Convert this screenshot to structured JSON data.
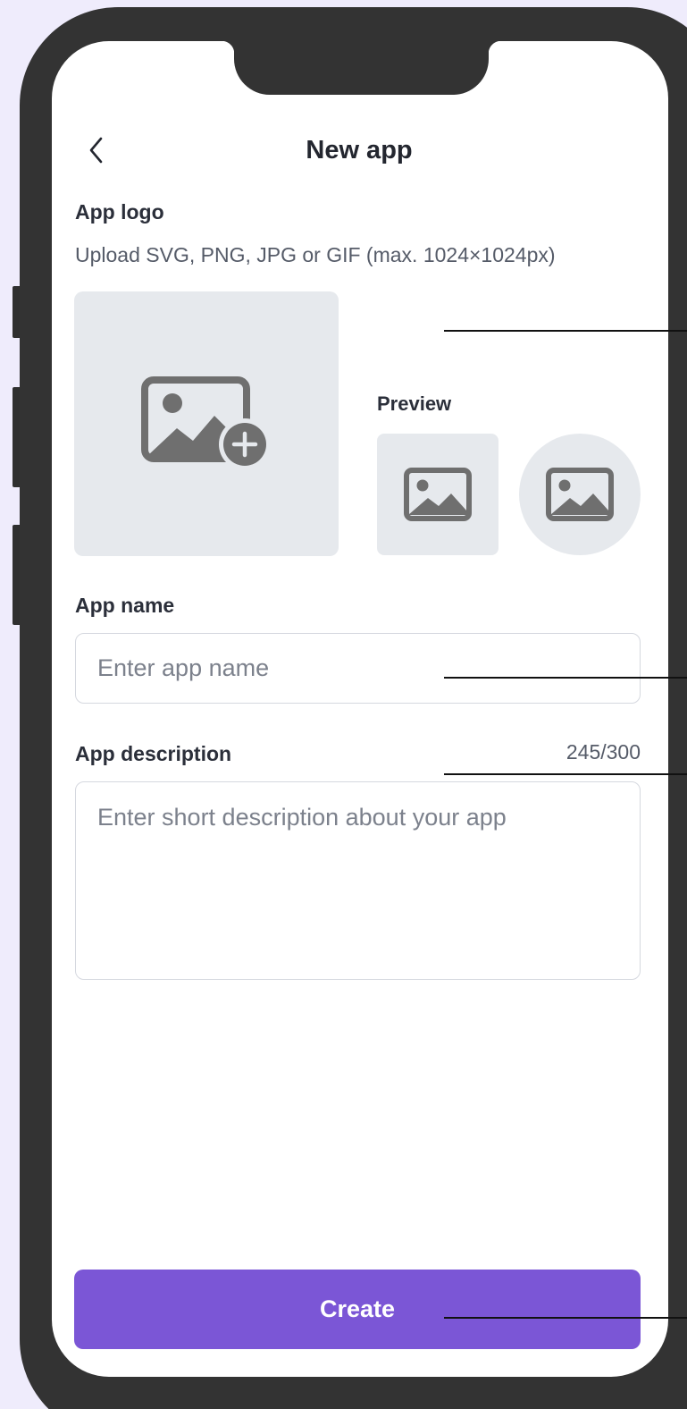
{
  "header": {
    "title": "New app",
    "back_icon": "chevron-left-icon"
  },
  "logo": {
    "label": "App logo",
    "helper": "Upload SVG, PNG, JPG or GIF (max. 1024×1024px)",
    "upload_icon": "image-add-icon",
    "preview_label": "Preview",
    "preview_icon": "image-icon"
  },
  "app_name": {
    "label": "App name",
    "placeholder": "Enter app name",
    "value": ""
  },
  "app_description": {
    "label": "App description",
    "counter": "245/300",
    "placeholder": "Enter short description about your app",
    "value": ""
  },
  "actions": {
    "create_label": "Create"
  },
  "colors": {
    "background": "#efecfc",
    "frame": "#333333",
    "primary": "#7b56d6",
    "tile": "#e6e9ed",
    "icon": "#6f6f6f"
  }
}
